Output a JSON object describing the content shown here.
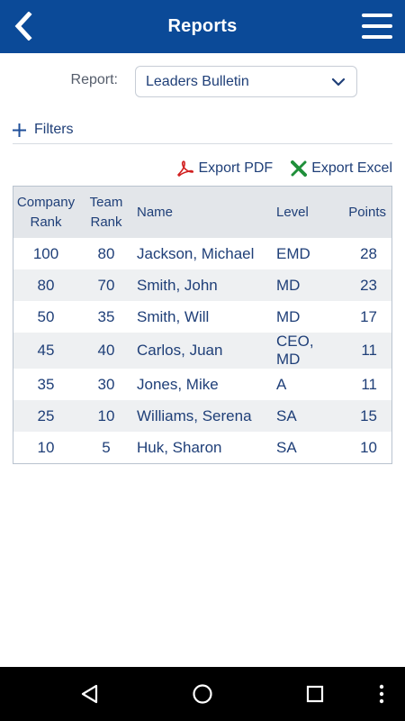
{
  "header": {
    "title": "Reports",
    "color": "#0b4a98"
  },
  "report_selector": {
    "label": "Report:",
    "value": "Leaders Bulletin"
  },
  "filters": {
    "label": "Filters"
  },
  "exports": {
    "pdf_label": "Export PDF",
    "excel_label": "Export Excel"
  },
  "table": {
    "headers": {
      "company_rank_line1": "Company",
      "company_rank_line2": "Rank",
      "team_rank_line1": "Team",
      "team_rank_line2": "Rank",
      "name": "Name",
      "level": "Level",
      "points": "Points"
    },
    "rows": [
      {
        "company_rank": "100",
        "team_rank": "80",
        "name": "Jackson, Michael",
        "level": "EMD",
        "points": "28"
      },
      {
        "company_rank": "80",
        "team_rank": "70",
        "name": "Smith, John",
        "level": "MD",
        "points": "23"
      },
      {
        "company_rank": "50",
        "team_rank": "35",
        "name": "Smith, Will",
        "level": "MD",
        "points": "17"
      },
      {
        "company_rank": "45",
        "team_rank": "40",
        "name": "Carlos, Juan",
        "level": "CEO, MD",
        "points": "11"
      },
      {
        "company_rank": "35",
        "team_rank": "30",
        "name": "Jones, Mike",
        "level": "A",
        "points": "11"
      },
      {
        "company_rank": "25",
        "team_rank": "10",
        "name": "Williams, Serena",
        "level": "SA",
        "points": "15"
      },
      {
        "company_rank": "10",
        "team_rank": "5",
        "name": "Huk, Sharon",
        "level": "SA",
        "points": "10"
      }
    ]
  },
  "navbar": {
    "icons": [
      "back-triangle-icon",
      "home-circle-icon",
      "recents-square-icon",
      "more-vert-icon"
    ]
  }
}
